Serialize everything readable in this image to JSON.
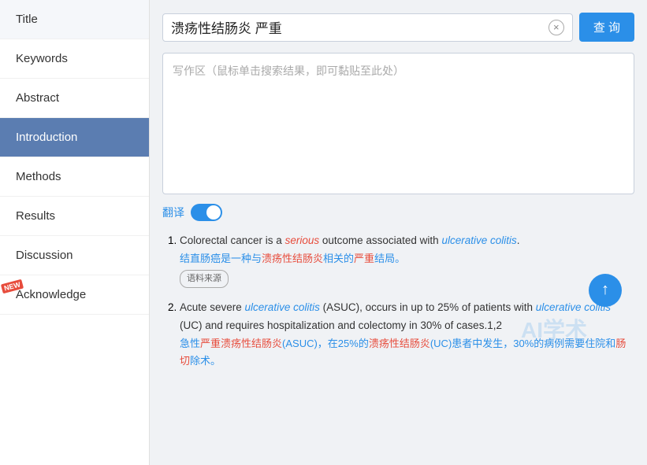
{
  "sidebar": {
    "items": [
      {
        "id": "title",
        "label": "Title",
        "active": false,
        "new": false
      },
      {
        "id": "keywords",
        "label": "Keywords",
        "active": false,
        "new": false
      },
      {
        "id": "abstract",
        "label": "Abstract",
        "active": false,
        "new": false
      },
      {
        "id": "introduction",
        "label": "Introduction",
        "active": true,
        "new": false
      },
      {
        "id": "methods",
        "label": "Methods",
        "active": false,
        "new": false
      },
      {
        "id": "results",
        "label": "Results",
        "active": false,
        "new": false
      },
      {
        "id": "discussion",
        "label": "Discussion",
        "active": false,
        "new": false
      },
      {
        "id": "acknowledge",
        "label": "Acknowledge",
        "active": false,
        "new": true
      }
    ]
  },
  "search": {
    "query": "溃疡性结肠炎 严重",
    "placeholder": "写作区（鼠标单击搜索结果，即可黏贴至此处）",
    "btn_label": "查 询",
    "clear_btn": "×"
  },
  "translate": {
    "label": "翻译",
    "enabled": true
  },
  "results": [
    {
      "number": "1.",
      "en_parts": [
        {
          "text": "Colorectal cancer is a ",
          "type": "normal"
        },
        {
          "text": "serious",
          "type": "italic-red"
        },
        {
          "text": " outcome associated with ",
          "type": "normal"
        },
        {
          "text": "ulcerative colitis",
          "type": "italic-blue"
        },
        {
          "text": ".",
          "type": "normal"
        }
      ],
      "cn_text": "结直肠癌是一种与溃疡性结肠炎相关的严重结局。",
      "source_tag": "语料来源"
    },
    {
      "number": "2.",
      "en_parts": [
        {
          "text": "Acute severe ",
          "type": "normal"
        },
        {
          "text": "ulcerative colitis",
          "type": "italic-blue"
        },
        {
          "text": " (ASUC), occurs in up to 25% of patients with ",
          "type": "normal"
        },
        {
          "text": "ulcerative colitis",
          "type": "italic-blue"
        },
        {
          "text": " (UC) and requires hospitalization and colectomy in 30% of cases.1,2",
          "type": "normal"
        }
      ],
      "cn_text": "急性严重溃疡性结肠炎(ASUC)，在25%的溃疡性结肠炎(UC)患者中发生，30%的病例需要住院和肠切除术。",
      "source_tag": null
    }
  ],
  "scroll_top": "↑",
  "watermark": "AI学术"
}
